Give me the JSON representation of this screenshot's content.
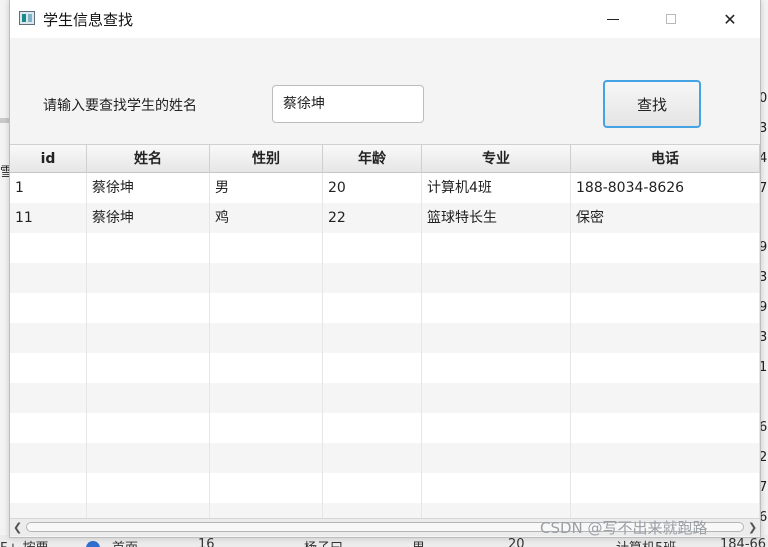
{
  "window": {
    "title": "学生信息查找"
  },
  "search": {
    "prompt": "请输入要查找学生的姓名",
    "value": "蔡徐坤",
    "button_label": "查找"
  },
  "table": {
    "columns": [
      "id",
      "姓名",
      "性别",
      "年龄",
      "专业",
      "电话"
    ],
    "rows": [
      [
        "1",
        "蔡徐坤",
        "男",
        "20",
        "计算机4班",
        "188-8034-8626"
      ],
      [
        "11",
        "蔡徐坤",
        "鸡",
        "22",
        "篮球特长生",
        "保密"
      ]
    ]
  },
  "background": {
    "right_digits": [
      "0",
      "3",
      "4",
      "7",
      "9",
      "3",
      "9",
      "3",
      "1",
      "6",
      "2",
      "7",
      "6"
    ],
    "left_char": "雪",
    "bottom_texts": [
      "F+ 按要",
      "首面",
      "16",
      "杨子曰",
      "男",
      "20",
      "计算机5班",
      "184-66"
    ]
  },
  "watermark": "CSDN @写不出来就跑路"
}
